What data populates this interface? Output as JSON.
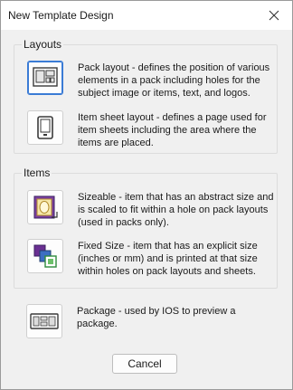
{
  "window": {
    "title": "New Template Design"
  },
  "layouts": {
    "label": "Layouts",
    "pack": {
      "desc": "Pack layout - defines the position of various elements in a pack including holes for the subject image or items, text, and logos."
    },
    "item_sheet": {
      "desc": "Item sheet layout - defines a page used for item sheets including the area where the items are placed."
    }
  },
  "items": {
    "label": "Items",
    "sizeable": {
      "desc": "Sizeable - item that has an abstract size and is scaled to fit within a hole on pack layouts (used in packs only)."
    },
    "fixed": {
      "desc": "Fixed Size - item that has an explicit size (inches or mm) and is printed at that size within holes on pack layouts and sheets."
    }
  },
  "package": {
    "desc": "Package - used by IOS to preview a package."
  },
  "buttons": {
    "cancel": "Cancel"
  },
  "icons": {
    "close": "close-icon",
    "pack": "pack-layout-icon",
    "item_sheet": "item-sheet-icon",
    "sizeable": "sizeable-item-icon",
    "fixed": "fixed-size-item-icon",
    "package": "package-icon"
  }
}
